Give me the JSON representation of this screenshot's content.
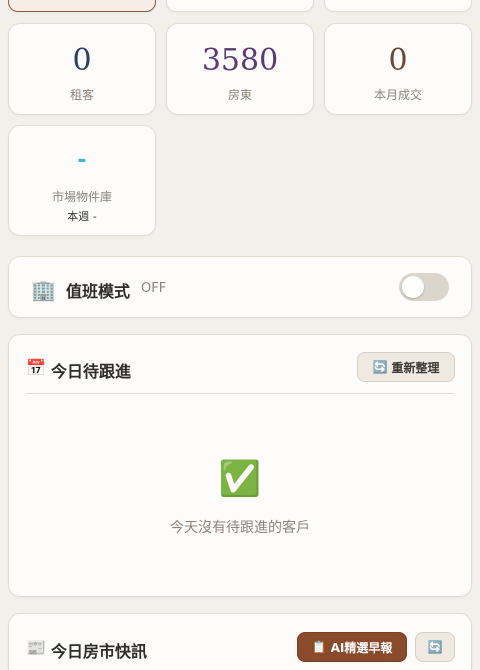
{
  "top_cards": [
    {
      "active": true
    },
    {
      "active": false
    },
    {
      "active": false
    }
  ],
  "stats": [
    {
      "value": "0",
      "label": "租客",
      "color": "#2b3f63"
    },
    {
      "value": "3580",
      "label": "房東",
      "color": "#5b3a78"
    },
    {
      "value": "0",
      "label": "本月成交",
      "color": "#6b4a35"
    }
  ],
  "market": {
    "value": "-",
    "label": "市場物件庫",
    "sub": "本週 -"
  },
  "duty": {
    "icon": "🏢",
    "title": "值班模式",
    "state": "OFF",
    "toggle_on": false
  },
  "followup": {
    "icon": "📅",
    "title": "今日待跟進",
    "refresh_icon": "🔄",
    "refresh_label": "重新整理",
    "empty_icon": "✅",
    "empty_text": "今天沒有待跟進的客戶"
  },
  "news": {
    "icon": "📰",
    "title": "今日房市快訊",
    "ai_icon": "📋",
    "ai_label": "AI精選早報",
    "refresh_icon": "🔄"
  }
}
